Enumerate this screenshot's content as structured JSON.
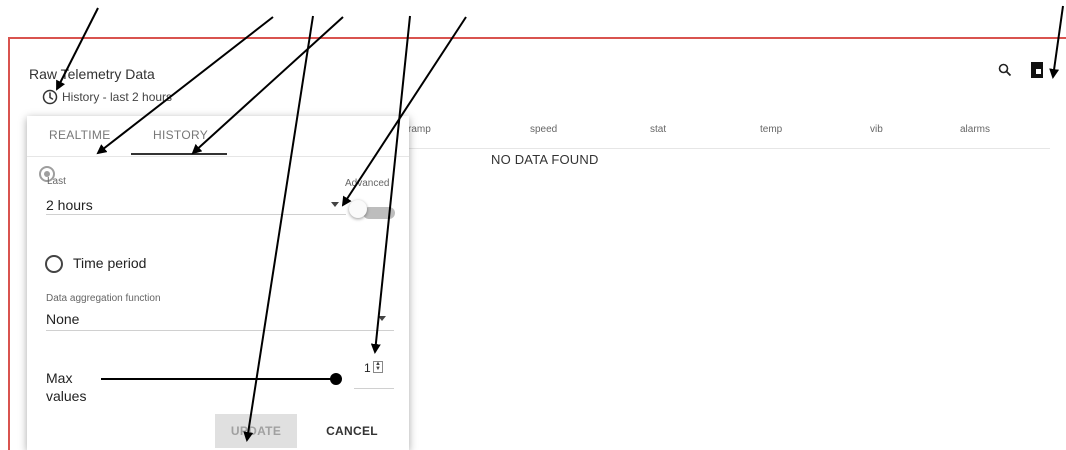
{
  "widget": {
    "title": "Raw Telemetry Data",
    "history_label": "History - last 2 hours",
    "accent_color": "#d9534f",
    "icons": [
      "clock-icon",
      "search-icon",
      "fullscreen-icon"
    ]
  },
  "table": {
    "columns": [
      "ramp",
      "speed",
      "stat",
      "temp",
      "vib",
      "alarms"
    ],
    "empty_text": "NO DATA FOUND"
  },
  "popup": {
    "tabs": [
      "REALTIME",
      "HISTORY"
    ],
    "active_tab": "HISTORY",
    "last": {
      "label": "Last",
      "value": "2 hours",
      "selected": true
    },
    "advanced_label": "Advanced",
    "advanced_enabled": false,
    "time_period_label": "Time period",
    "aggregation": {
      "label": "Data aggregation function",
      "value": "None"
    },
    "max_values": {
      "label_line1": "Max",
      "label_line2": "values",
      "value": "1"
    },
    "update_label": "UPDATE",
    "cancel_label": "CANCEL"
  }
}
